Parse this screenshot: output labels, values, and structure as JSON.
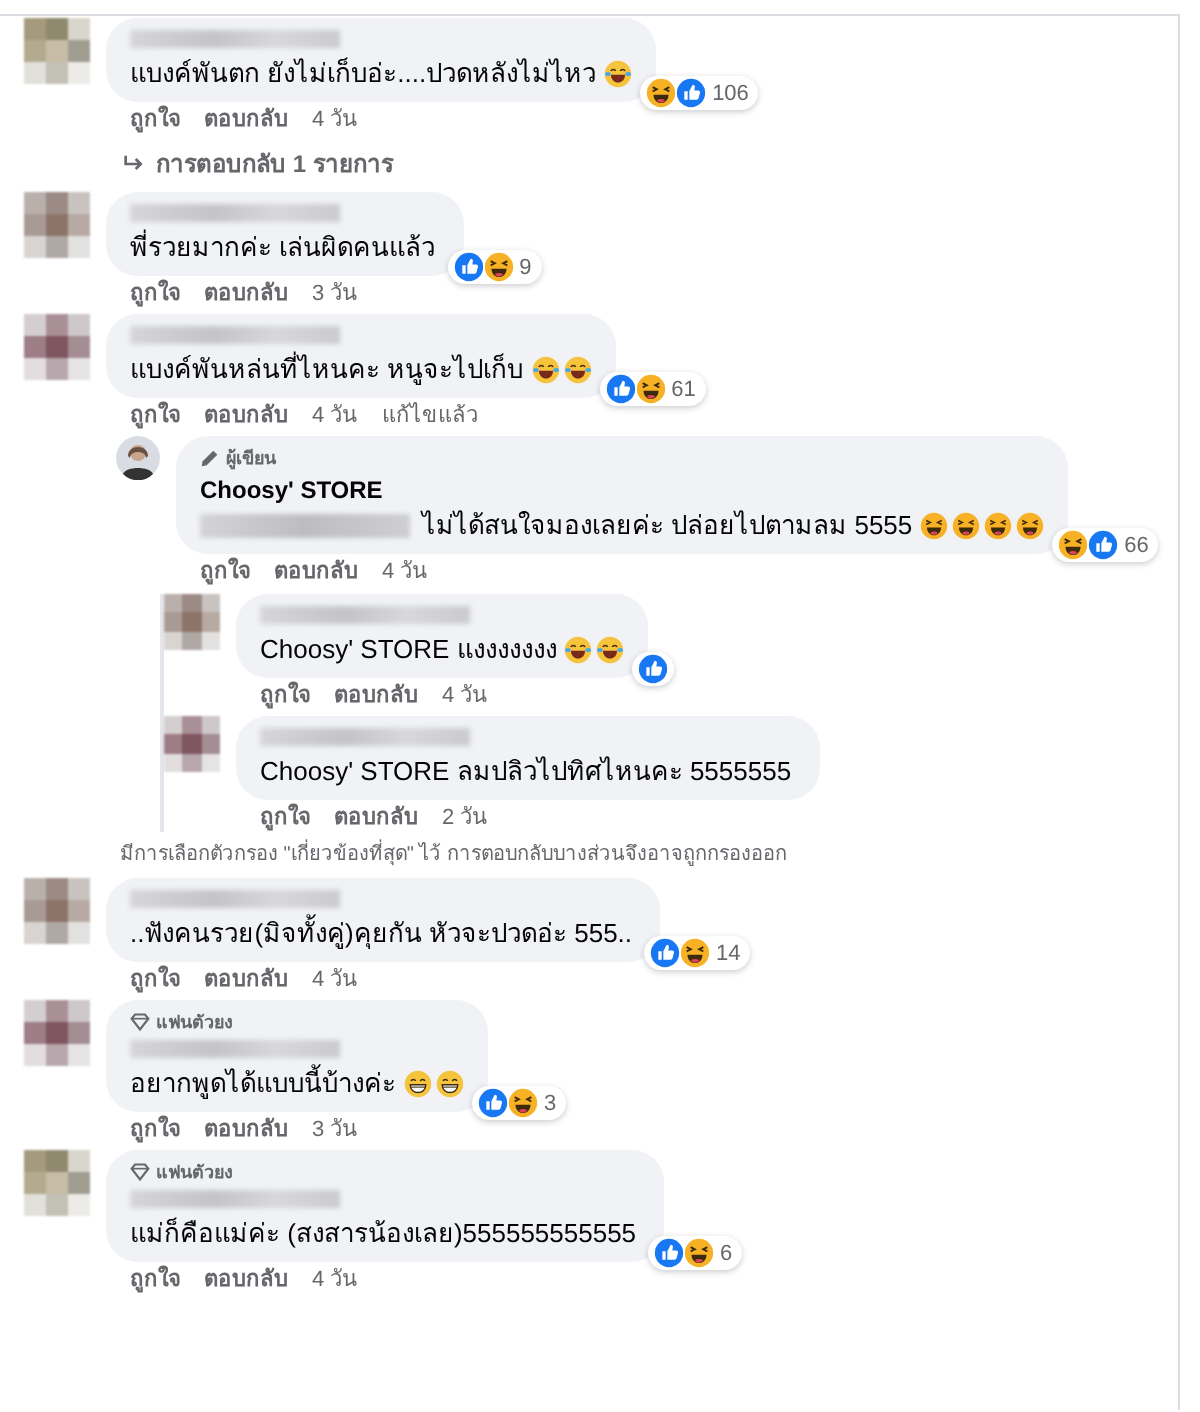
{
  "comments": [
    {
      "avatar": {
        "kind": "mosaic"
      },
      "text": "แบงค์พันตก ยังไม่เก็บอ่ะ....ปวดหลังไม่ไหว",
      "emojis": [
        {
          "kind": "tears"
        }
      ],
      "reactions": {
        "icons": [
          {
            "kind": "haha"
          },
          {
            "kind": "like"
          }
        ],
        "count": "106"
      },
      "footer": [
        {
          "kind": "link",
          "text": "ถูกใจ"
        },
        {
          "kind": "link",
          "text": "ตอบกลับ"
        },
        {
          "kind": "time",
          "text": "4 วัน"
        }
      ],
      "replies_link": "การตอบกลับ 1 รายการ"
    },
    {
      "avatar": {
        "kind": "mosaic"
      },
      "text": "พี่รวยมากค่ะ เล่นผิดคนแล้ว",
      "reactions": {
        "icons": [
          {
            "kind": "like"
          },
          {
            "kind": "haha"
          }
        ],
        "count": "9"
      },
      "footer": [
        {
          "kind": "link",
          "text": "ถูกใจ"
        },
        {
          "kind": "link",
          "text": "ตอบกลับ"
        },
        {
          "kind": "time",
          "text": "3 วัน"
        }
      ]
    },
    {
      "avatar": {
        "kind": "mosaic"
      },
      "text": "แบงค์พันหล่นที่ไหนคะ หนูจะไปเก็บ",
      "emojis": [
        {
          "kind": "tears"
        },
        {
          "kind": "tears"
        }
      ],
      "reactions": {
        "icons": [
          {
            "kind": "like"
          },
          {
            "kind": "haha"
          }
        ],
        "count": "61"
      },
      "footer": [
        {
          "kind": "link",
          "text": "ถูกใจ"
        },
        {
          "kind": "link",
          "text": "ตอบกลับ"
        },
        {
          "kind": "time",
          "text": "4 วัน"
        },
        {
          "kind": "time",
          "text": "แก้ไขแล้ว"
        }
      ],
      "replies": [
        {
          "avatar": {
            "kind": "photo"
          },
          "badge": {
            "kind": "author",
            "label": "ผู้เขียน"
          },
          "author": "Choosy' STORE",
          "mention_hidden": true,
          "text": "ไม่ได้สนใจมองเลยค่ะ ปล่อยไปตามลม 5555",
          "emojis": [
            {
              "kind": "squint"
            },
            {
              "kind": "squint"
            },
            {
              "kind": "squint"
            },
            {
              "kind": "squint"
            }
          ],
          "reactions": {
            "icons": [
              {
                "kind": "haha"
              },
              {
                "kind": "like"
              }
            ],
            "count": "66"
          },
          "footer": [
            {
              "kind": "link",
              "text": "ถูกใจ"
            },
            {
              "kind": "link",
              "text": "ตอบกลับ"
            },
            {
              "kind": "time",
              "text": "4 วัน"
            }
          ],
          "replies": [
            {
              "avatar": {
                "kind": "mosaic"
              },
              "text": "Choosy' STORE แงงงงงงง",
              "emojis": [
                {
                  "kind": "tears"
                },
                {
                  "kind": "tears"
                }
              ],
              "reactions": {
                "icons": [
                  {
                    "kind": "like"
                  }
                ]
              },
              "footer": [
                {
                  "kind": "link",
                  "text": "ถูกใจ"
                },
                {
                  "kind": "link",
                  "text": "ตอบกลับ"
                },
                {
                  "kind": "time",
                  "text": "4 วัน"
                }
              ]
            },
            {
              "avatar": {
                "kind": "mosaic"
              },
              "text": "Choosy' STORE ลมปลิวไปทิศไหนคะ 5555555",
              "footer": [
                {
                  "kind": "link",
                  "text": "ถูกใจ"
                },
                {
                  "kind": "link",
                  "text": "ตอบกลับ"
                },
                {
                  "kind": "time",
                  "text": "2 วัน"
                }
              ]
            }
          ]
        }
      ]
    },
    {
      "kind": "note",
      "text": "มีการเลือกตัวกรอง \"เกี่ยวข้องที่สุด\" ไว้ การตอบกลับบางส่วนจึงอาจถูกกรองออก"
    },
    {
      "avatar": {
        "kind": "mosaic"
      },
      "text": "..ฟังคนรวย(มิจทั้งคู่)คุยกัน หัวจะปวดอ่ะ 555..",
      "reactions": {
        "icons": [
          {
            "kind": "like"
          },
          {
            "kind": "haha"
          }
        ],
        "count": "14"
      },
      "footer": [
        {
          "kind": "link",
          "text": "ถูกใจ"
        },
        {
          "kind": "link",
          "text": "ตอบกลับ"
        },
        {
          "kind": "time",
          "text": "4 วัน"
        }
      ]
    },
    {
      "avatar": {
        "kind": "mosaic"
      },
      "badge": {
        "kind": "fan",
        "label": "แฟนตัวยง"
      },
      "text": "อยากพูดได้แบบนี้บ้างค่ะ",
      "emojis": [
        {
          "kind": "grin"
        },
        {
          "kind": "grin"
        }
      ],
      "reactions": {
        "icons": [
          {
            "kind": "like"
          },
          {
            "kind": "haha"
          }
        ],
        "count": "3"
      },
      "footer": [
        {
          "kind": "link",
          "text": "ถูกใจ"
        },
        {
          "kind": "link",
          "text": "ตอบกลับ"
        },
        {
          "kind": "time",
          "text": "3 วัน"
        }
      ]
    },
    {
      "avatar": {
        "kind": "mosaic"
      },
      "badge": {
        "kind": "fan",
        "label": "แฟนตัวยง"
      },
      "text": "แม่ก็คือแม่ค่ะ (สงสารน้องเลย)555555555555",
      "reactions": {
        "icons": [
          {
            "kind": "like"
          },
          {
            "kind": "haha"
          }
        ],
        "count": "6"
      },
      "footer": [
        {
          "kind": "link",
          "text": "ถูกใจ"
        },
        {
          "kind": "link",
          "text": "ตอบกลับ"
        },
        {
          "kind": "time",
          "text": "4 วัน"
        }
      ]
    }
  ]
}
